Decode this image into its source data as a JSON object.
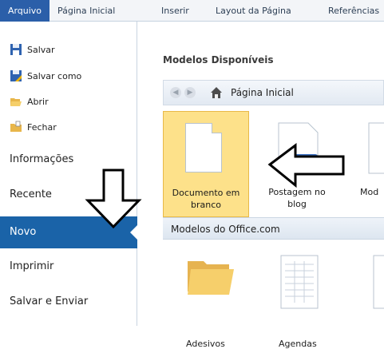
{
  "ribbon": {
    "tabs": [
      "Arquivo",
      "Página Inicial",
      "Inserir",
      "Layout da Página",
      "Referências"
    ]
  },
  "left": {
    "commands": [
      "Salvar",
      "Salvar como",
      "Abrir",
      "Fechar"
    ],
    "nav": [
      "Informações",
      "Recente",
      "Novo",
      "Imprimir",
      "Salvar e Enviar"
    ],
    "active": "Novo"
  },
  "main": {
    "title": "Modelos Disponíveis",
    "breadcrumb": "Página Inicial",
    "templates": [
      {
        "label_line1": "Documento em",
        "label_line2": "branco"
      },
      {
        "label_line1": "Postagem no",
        "label_line2": "blog"
      },
      {
        "label_line1": "Mod",
        "label_line2": ""
      }
    ],
    "office_section": "Modelos do Office.com",
    "bottom_labels": [
      "Adesivos",
      "Agendas"
    ]
  },
  "colors": {
    "accent": "#1a63a8",
    "selected_tile": "#fde18a",
    "file_tab": "#2b5fa9"
  }
}
